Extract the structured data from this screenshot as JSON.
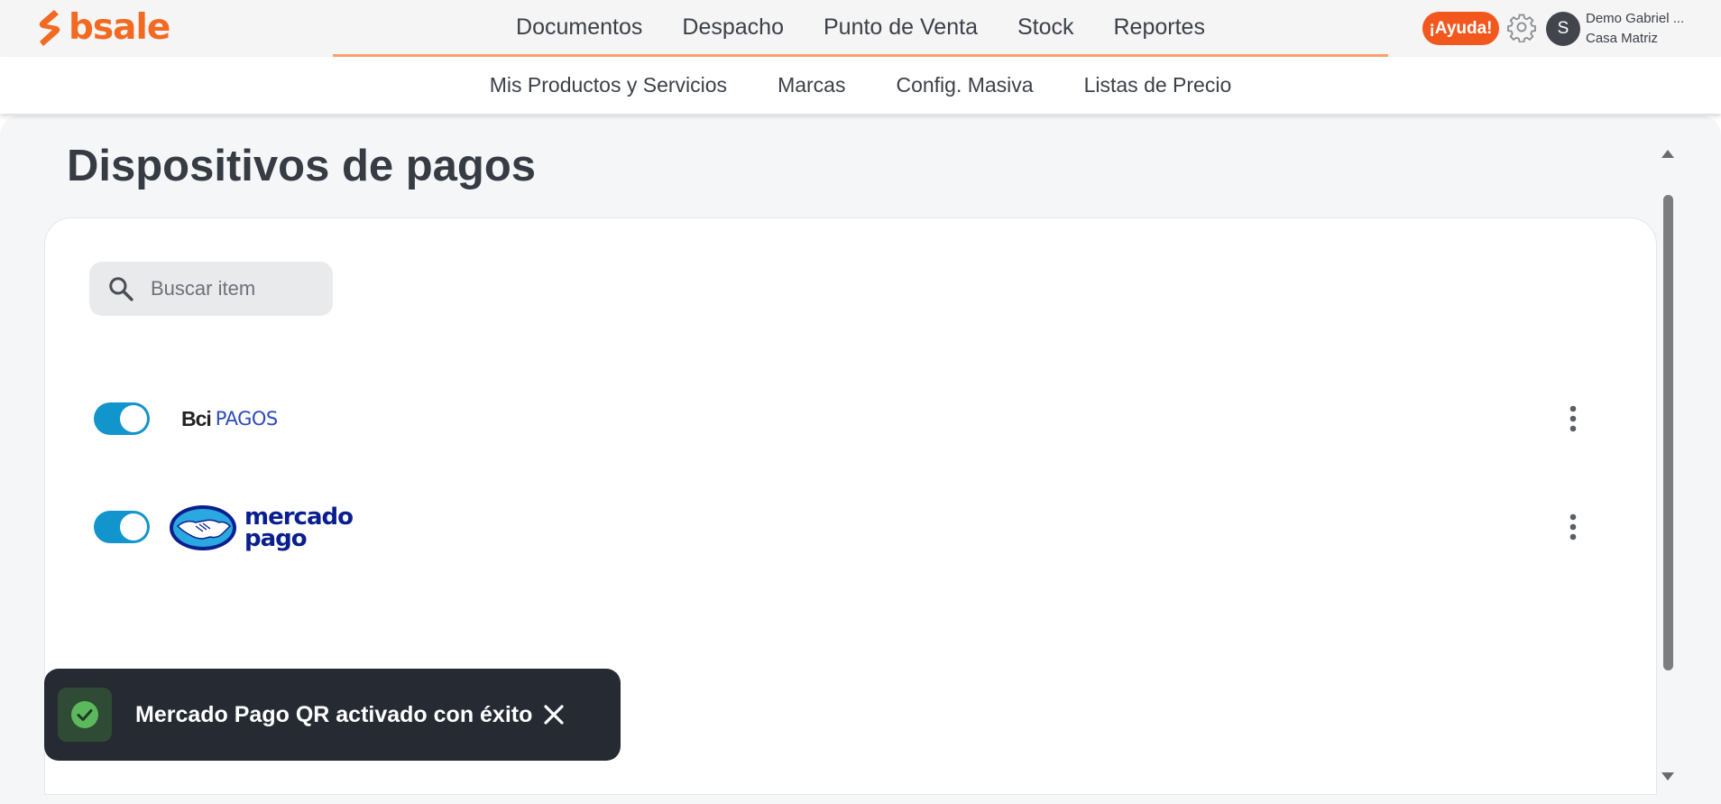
{
  "brand": {
    "name": "bsale",
    "color": "#f26a21"
  },
  "nav": {
    "main": [
      "Documentos",
      "Despacho",
      "Punto de Venta",
      "Stock",
      "Reportes"
    ],
    "sub": [
      "Mis Productos y Servicios",
      "Marcas",
      "Config. Masiva",
      "Listas de Precio"
    ]
  },
  "header": {
    "help_label": "¡Ayuda!",
    "avatar_initial": "S",
    "user_name": "Demo Gabriel ...",
    "user_branch": "Casa Matriz",
    "gear_icon": "gear-icon"
  },
  "page": {
    "title": "Dispositivos de pagos"
  },
  "search": {
    "placeholder": "Buscar item",
    "value": ""
  },
  "devices": [
    {
      "brand_prefix": "Bci",
      "brand_suffix": "PAGOS",
      "enabled": true
    },
    {
      "brand_line1": "mercado",
      "brand_line2": "pago",
      "enabled": true
    }
  ],
  "toast": {
    "message": "Mercado Pago QR activado con éxito",
    "status": "success"
  },
  "colors": {
    "accent": "#f2581e",
    "toggle_on": "#1294cc",
    "toast_bg": "#262a33",
    "success": "#5cb85c"
  }
}
